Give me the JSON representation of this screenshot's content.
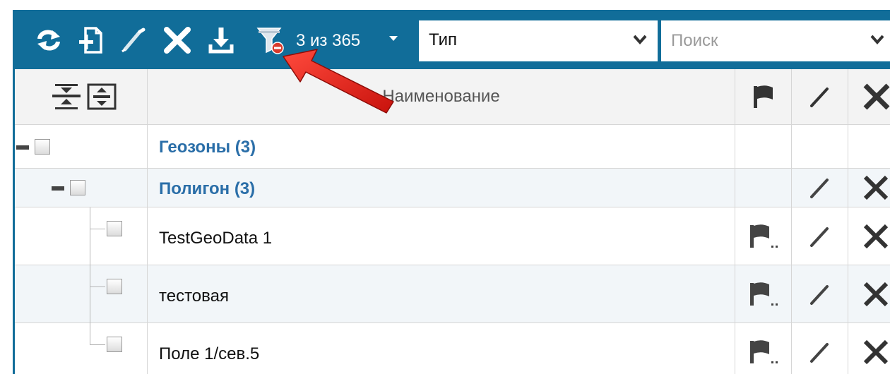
{
  "toolbar": {
    "buttons": [
      "refresh-icon",
      "add-document-icon",
      "edit-icon",
      "delete-icon",
      "download-icon",
      "filter-clear-icon"
    ],
    "count_text": "3 из 365",
    "type_select_value": "Тип",
    "search_placeholder": "Поиск"
  },
  "grid": {
    "header": {
      "name_column": "Наименование"
    },
    "rows": [
      {
        "label": "Геозоны (3)",
        "level": 0,
        "kind": "group"
      },
      {
        "label": "Полигон (3)",
        "level": 1,
        "kind": "group"
      },
      {
        "label": "TestGeoData 1",
        "level": 2,
        "kind": "item"
      },
      {
        "label": "тестовая",
        "level": 2,
        "kind": "item"
      },
      {
        "label": "Поле 1/сев.5",
        "level": 2,
        "kind": "item"
      }
    ]
  },
  "colors": {
    "toolbar_bg": "#116d99",
    "group_text": "#2a6ea8",
    "arrow": "#e8231e"
  }
}
